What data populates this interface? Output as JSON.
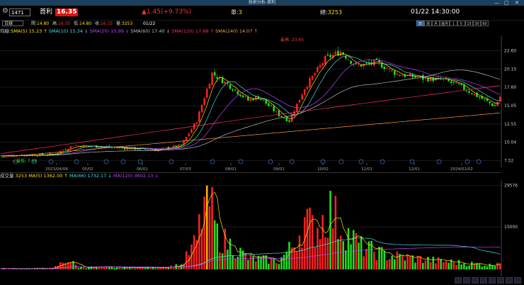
{
  "window": {
    "title": "技術分析-首利",
    "controls": [
      "—",
      "□",
      "✕"
    ]
  },
  "header": {
    "code": "1471",
    "name": "首利",
    "price": "16.35",
    "change": "▲1.45(+9.73%)",
    "unit_label": "單:",
    "unit_value": "3",
    "total_label": "總:",
    "total_value": "3253",
    "datetime": "01/22 14:30:00"
  },
  "ohlc_bar": {
    "period": "日線",
    "open_label": "開:",
    "open": "14.80",
    "high_label": "高:",
    "high": "16.35",
    "low_label": "低:",
    "low": "14.80",
    "close_label": "收:",
    "close": "16.35",
    "volume_label": "量:",
    "volume": "3253",
    "date": "01/22"
  },
  "period_tabs": [
    "日",
    "週",
    "月",
    "還月",
    "1",
    "5",
    "15",
    "30",
    "60"
  ],
  "ma_bar": {
    "label": "均線:",
    "items": [
      {
        "text": "SMA(5) 15.23 ↑",
        "color": "#ffe000"
      },
      {
        "text": "SMA(10) 15.34 ↓",
        "color": "#40e0e0"
      },
      {
        "text": "SMA(20) 15.99 ↓",
        "color": "#c040ff"
      },
      {
        "text": "SMA(60) 17.40 ↓",
        "color": "#bbbbbb"
      },
      {
        "text": "SMA(120) 17.88 ↑",
        "color": "#ff3060"
      },
      {
        "text": "SMA(240) 14.07 ↑",
        "color": "#ff9a30"
      }
    ]
  },
  "price_axis": [
    "22.60",
    "20.10",
    "17.60",
    "15.05",
    "12.55",
    "10.04",
    "7.52"
  ],
  "date_axis": [
    "2023/04/06",
    "05/02",
    "06/01",
    "07/03",
    "08/01",
    "09/01",
    "10/02",
    "11/01",
    "12/01",
    "2024/01/02"
  ],
  "annotations": {
    "high": "最高: 23.65",
    "low": "最低: 7.66"
  },
  "vol_bar": {
    "label": "成交量",
    "items": [
      {
        "text": "3253",
        "color": "#ffe000"
      },
      {
        "text": "MA(5) 1362.00 ↑",
        "color": "#ffe000"
      },
      {
        "text": "MA(66) 1732.17 ↓",
        "color": "#40e0e0"
      },
      {
        "text": "MA(120) 4602.13 ↓",
        "color": "#c040ff"
      }
    ]
  },
  "vol_axis": [
    "29576",
    "15000"
  ],
  "colors": {
    "up": "#ff2020",
    "down": "#20e020",
    "accent": "#2a5c9a"
  }
}
